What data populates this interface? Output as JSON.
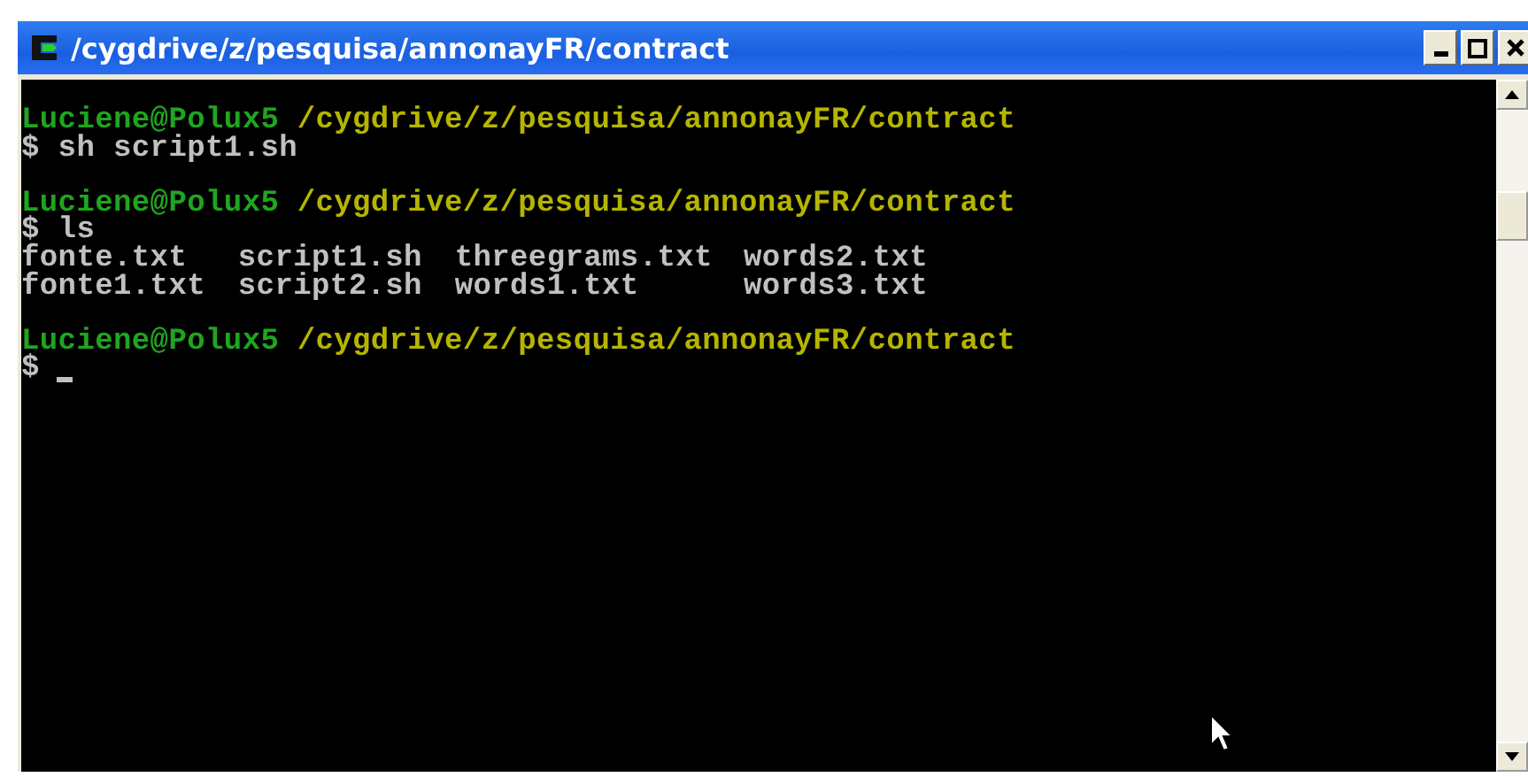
{
  "window": {
    "title": "/cygdrive/z/pesquisa/annonayFR/contract"
  },
  "terminal": {
    "lines": [
      {
        "kind": "prompt",
        "user": "Luciene@Polux5",
        "path": "/cygdrive/z/pesquisa/annonayFR/contract"
      },
      {
        "kind": "command",
        "prompt": "$",
        "text": "sh script1.sh"
      },
      {
        "kind": "blank"
      },
      {
        "kind": "prompt",
        "user": "Luciene@Polux5",
        "path": "/cygdrive/z/pesquisa/annonayFR/contract"
      },
      {
        "kind": "command",
        "prompt": "$",
        "text": "ls"
      },
      {
        "kind": "output",
        "cells": [
          "fonte.txt",
          "script1.sh",
          "threegrams.txt",
          "words2.txt"
        ]
      },
      {
        "kind": "output",
        "cells": [
          "fonte1.txt",
          "script2.sh",
          "words1.txt",
          "words3.txt"
        ]
      },
      {
        "kind": "blank"
      },
      {
        "kind": "prompt",
        "user": "Luciene@Polux5",
        "path": "/cygdrive/z/pesquisa/annonayFR/contract"
      },
      {
        "kind": "input",
        "prompt": "$",
        "cursor": true
      }
    ]
  }
}
